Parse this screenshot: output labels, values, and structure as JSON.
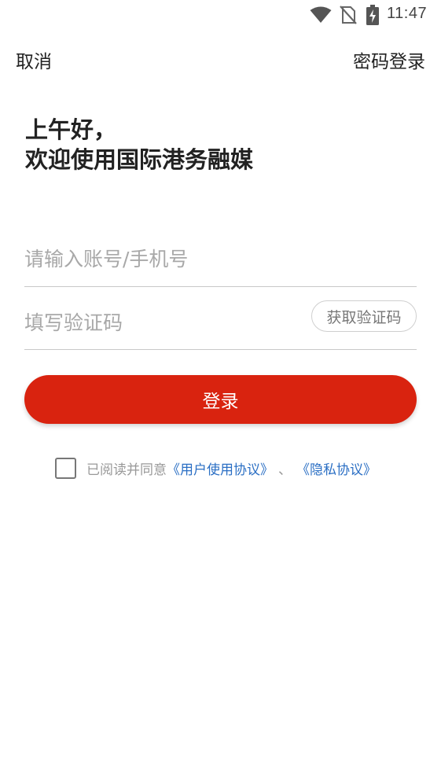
{
  "status_bar": {
    "time": "11:47",
    "icons": [
      "wifi-icon",
      "no-sim-icon",
      "battery-charging-icon"
    ]
  },
  "nav": {
    "cancel_label": "取消",
    "password_login_label": "密码登录"
  },
  "greeting": {
    "line1": "上午好，",
    "line2": "欢迎使用国际港务融媒"
  },
  "form": {
    "account_placeholder": "请输入账号/手机号",
    "account_value": "",
    "code_placeholder": "填写验证码",
    "code_value": "",
    "get_code_label": "获取验证码",
    "login_label": "登录"
  },
  "agreement": {
    "checked": false,
    "prefix": "已阅读并同意",
    "user_agreement": "《用户使用协议》",
    "separator": "、",
    "privacy_policy": "《隐私协议》"
  },
  "colors": {
    "accent": "#d9230f",
    "link": "#2b6fc4"
  }
}
